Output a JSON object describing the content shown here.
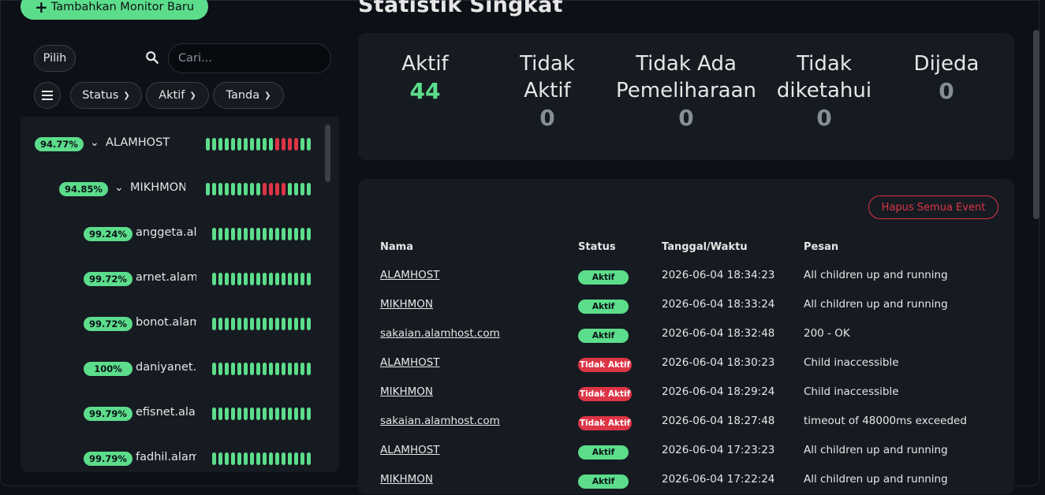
{
  "header": {
    "add_button_label": "Tambahkan Monitor Baru",
    "page_title": "Statistik Singkat"
  },
  "toolbar": {
    "select_label": "Pilih",
    "search_placeholder": "Cari...",
    "filters": [
      {
        "label": "Status"
      },
      {
        "label": "Aktif"
      },
      {
        "label": "Tanda"
      }
    ]
  },
  "monitors": [
    {
      "pct": "94.77%",
      "name": "ALAMHOST",
      "beats": "11111111111000011",
      "group": true
    },
    {
      "pct": "94.85%",
      "name": "MIKHMON",
      "beats": "11111111100001111",
      "group": true
    },
    {
      "pct": "99.24%",
      "name": "anggeta.alamhost.com",
      "beats": "1111111111111111"
    },
    {
      "pct": "99.72%",
      "name": "arnet.alamhost.com",
      "beats": "1111111111111111"
    },
    {
      "pct": "99.72%",
      "name": "bonot.alamhost.com",
      "beats": "1111111111111111"
    },
    {
      "pct": "100%",
      "name": "daniyanet.alamhost.com",
      "beats": "1111111111111111"
    },
    {
      "pct": "99.79%",
      "name": "efisnet.alamhost.com",
      "beats": "1111111111111111"
    },
    {
      "pct": "99.79%",
      "name": "fadhil.alamhost.com",
      "beats": "1111111111111111"
    }
  ],
  "stats": [
    {
      "label": "Aktif",
      "value": "44"
    },
    {
      "label": "Tidak Aktif",
      "value": "0"
    },
    {
      "label": "Tidak Ada Pemeliharaan",
      "value": "0"
    },
    {
      "label": "Tidak diketahui",
      "value": "0"
    },
    {
      "label": "Dijeda",
      "value": "0"
    }
  ],
  "events": {
    "clear_button_label": "Hapus Semua Event",
    "columns": [
      "Nama",
      "Status",
      "Tanggal/Waktu",
      "Pesan"
    ],
    "rows": [
      {
        "name": "ALAMHOST",
        "status": "Aktif",
        "time": "2026-06-04 18:34:23",
        "msg": "All children up and running"
      },
      {
        "name": "MIKHMON",
        "status": "Aktif",
        "time": "2026-06-04 18:33:24",
        "msg": "All children up and running"
      },
      {
        "name": "sakaian.alamhost.com",
        "status": "Aktif",
        "time": "2026-06-04 18:32:48",
        "msg": "200 - OK"
      },
      {
        "name": "ALAMHOST",
        "status": "Tidak Aktif",
        "time": "2026-06-04 18:30:23",
        "msg": "Child inaccessible"
      },
      {
        "name": "MIKHMON",
        "status": "Tidak Aktif",
        "time": "2026-06-04 18:29:24",
        "msg": "Child inaccessible"
      },
      {
        "name": "sakaian.alamhost.com",
        "status": "Tidak Aktif",
        "time": "2026-06-04 18:27:48",
        "msg": "timeout of 48000ms exceeded"
      },
      {
        "name": "ALAMHOST",
        "status": "Aktif",
        "time": "2026-06-04 17:23:23",
        "msg": "All children up and running"
      },
      {
        "name": "MIKHMON",
        "status": "Aktif",
        "time": "2026-06-04 17:22:24",
        "msg": "All children up and running"
      }
    ]
  },
  "colors": {
    "accent_green": "#5cdd8b",
    "danger_red": "#dc3545",
    "background": "#0d1117",
    "panel": "#161b22"
  }
}
